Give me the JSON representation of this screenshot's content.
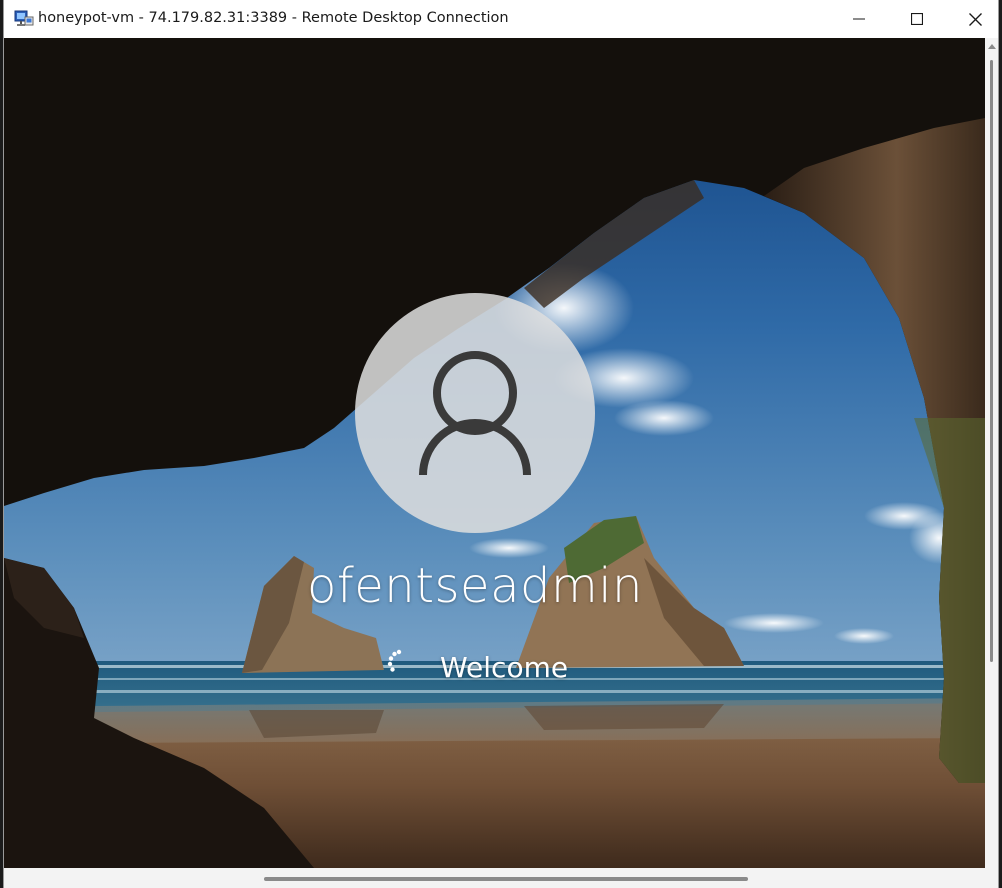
{
  "window": {
    "title": "honeypot-vm - 74.179.82.31:3389 - Remote Desktop Connection",
    "icon": "remote-desktop-icon"
  },
  "controls": {
    "minimize": "minimize-icon",
    "maximize": "maximize-icon",
    "close": "close-icon"
  },
  "lock_screen": {
    "username": "ofentseadmin",
    "status": "Welcome",
    "avatar_icon": "user-avatar-icon",
    "spinner_icon": "loading-spinner-icon"
  }
}
